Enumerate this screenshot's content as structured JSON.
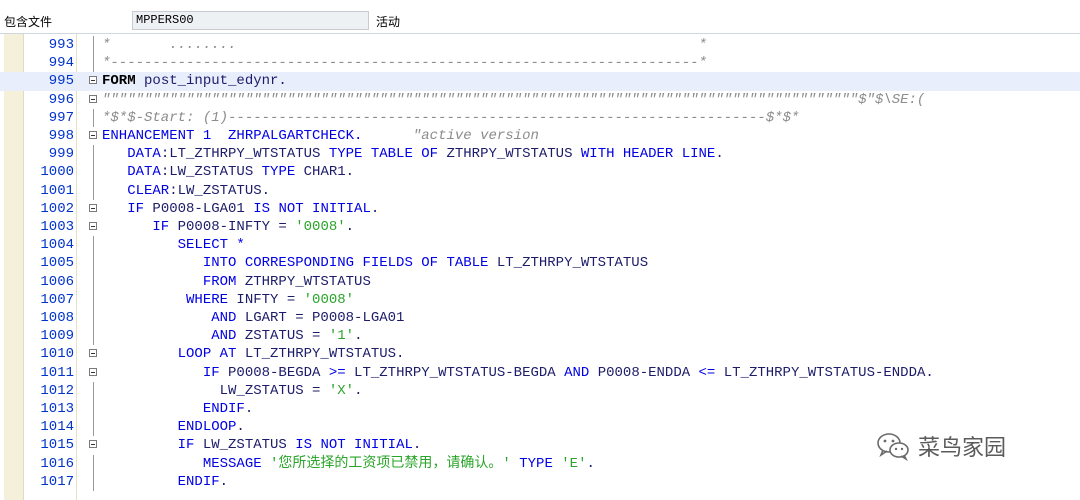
{
  "header": {
    "package_label": "包含文件",
    "include_name": "MPPERS00",
    "status": "活动"
  },
  "editor": {
    "lines": [
      {
        "n": "993",
        "segs": [
          {
            "t": "*       ........                                                       *",
            "c": "cm"
          }
        ]
      },
      {
        "n": "994",
        "segs": [
          {
            "t": "*----------------------------------------------------------------------*",
            "c": "cm"
          }
        ]
      },
      {
        "n": "995",
        "segs": [
          {
            "t": "FORM",
            "c": "bd"
          },
          {
            "t": " post_input_edynr.",
            "c": "tx"
          }
        ]
      },
      {
        "n": "996",
        "segs": [
          {
            "t": "\"\"\"\"\"\"\"\"\"\"\"\"\"\"\"\"\"\"\"\"\"\"\"\"\"\"\"\"\"\"\"\"\"\"\"\"\"\"\"\"\"\"\"\"\"\"\"\"\"\"\"\"\"\"\"\"\"\"\"\"\"\"\"\"\"\"\"\"\"\"\"\"\"\"\"\"\"\"\"\"\"\"\"\"\"\"\"\"\"\"$\"$\\SE:(",
            "c": "cm"
          }
        ]
      },
      {
        "n": "997",
        "segs": [
          {
            "t": "*$*$-Start: (1)----------------------------------------------------------------$*$*",
            "c": "cm"
          }
        ]
      },
      {
        "n": "998",
        "segs": [
          {
            "t": "ENHANCEMENT 1  ZHRPALGARTCHECK.      ",
            "c": "kw"
          },
          {
            "t": "\"active version",
            "c": "cm"
          }
        ]
      },
      {
        "n": "999",
        "segs": [
          {
            "t": "   DATA",
            "c": "kw"
          },
          {
            "t": ":LT_ZTHRPY_WTSTATUS ",
            "c": "tx"
          },
          {
            "t": "TYPE TABLE OF",
            "c": "kw"
          },
          {
            "t": " ZTHRPY_WTSTATUS ",
            "c": "tx"
          },
          {
            "t": "WITH HEADER LINE",
            "c": "kw"
          },
          {
            "t": ".",
            "c": "tx"
          }
        ]
      },
      {
        "n": "1000",
        "segs": [
          {
            "t": "   DATA",
            "c": "kw"
          },
          {
            "t": ":LW_ZSTATUS ",
            "c": "tx"
          },
          {
            "t": "TYPE",
            "c": "kw"
          },
          {
            "t": " CHAR1.",
            "c": "tx"
          }
        ]
      },
      {
        "n": "1001",
        "segs": [
          {
            "t": "   CLEAR",
            "c": "kw"
          },
          {
            "t": ":LW_ZSTATUS.",
            "c": "tx"
          }
        ]
      },
      {
        "n": "1002",
        "segs": [
          {
            "t": "   IF",
            "c": "kw"
          },
          {
            "t": " P0008-LGA01 ",
            "c": "tx"
          },
          {
            "t": "IS NOT INITIAL",
            "c": "kw"
          },
          {
            "t": ".",
            "c": "tx"
          }
        ]
      },
      {
        "n": "1003",
        "segs": [
          {
            "t": "      IF",
            "c": "kw"
          },
          {
            "t": " P0008-INFTY = ",
            "c": "tx"
          },
          {
            "t": "'0008'",
            "c": "st"
          },
          {
            "t": ".",
            "c": "tx"
          }
        ]
      },
      {
        "n": "1004",
        "segs": [
          {
            "t": "         SELECT *",
            "c": "kw"
          }
        ]
      },
      {
        "n": "1005",
        "segs": [
          {
            "t": "            INTO CORRESPONDING FIELDS OF TABLE",
            "c": "kw"
          },
          {
            "t": " LT_ZTHRPY_WTSTATUS",
            "c": "tx"
          }
        ]
      },
      {
        "n": "1006",
        "segs": [
          {
            "t": "            FROM",
            "c": "kw"
          },
          {
            "t": " ZTHRPY_WTSTATUS",
            "c": "tx"
          }
        ]
      },
      {
        "n": "1007",
        "segs": [
          {
            "t": "          WHERE",
            "c": "kw"
          },
          {
            "t": " INFTY = ",
            "c": "tx"
          },
          {
            "t": "'0008'",
            "c": "st"
          }
        ]
      },
      {
        "n": "1008",
        "segs": [
          {
            "t": "             AND",
            "c": "kw"
          },
          {
            "t": " LGART = P0008-LGA01",
            "c": "tx"
          }
        ]
      },
      {
        "n": "1009",
        "segs": [
          {
            "t": "             AND",
            "c": "kw"
          },
          {
            "t": " ZSTATUS = ",
            "c": "tx"
          },
          {
            "t": "'1'",
            "c": "st"
          },
          {
            "t": ".",
            "c": "tx"
          }
        ]
      },
      {
        "n": "1010",
        "segs": [
          {
            "t": "         LOOP AT",
            "c": "kw"
          },
          {
            "t": " LT_ZTHRPY_WTSTATUS.",
            "c": "tx"
          }
        ]
      },
      {
        "n": "1011",
        "segs": [
          {
            "t": "            IF",
            "c": "kw"
          },
          {
            "t": " P0008-BEGDA ",
            "c": "tx"
          },
          {
            "t": ">=",
            "c": "kw"
          },
          {
            "t": " LT_ZTHRPY_WTSTATUS-BEGDA ",
            "c": "tx"
          },
          {
            "t": "AND",
            "c": "kw"
          },
          {
            "t": " P0008-ENDDA ",
            "c": "tx"
          },
          {
            "t": "<=",
            "c": "kw"
          },
          {
            "t": " LT_ZTHRPY_WTSTATUS-ENDDA.",
            "c": "tx"
          }
        ]
      },
      {
        "n": "1012",
        "segs": [
          {
            "t": "              LW_ZSTATUS = ",
            "c": "tx"
          },
          {
            "t": "'X'",
            "c": "st"
          },
          {
            "t": ".",
            "c": "tx"
          }
        ]
      },
      {
        "n": "1013",
        "segs": [
          {
            "t": "            ENDIF",
            "c": "kw"
          },
          {
            "t": ".",
            "c": "tx"
          }
        ]
      },
      {
        "n": "1014",
        "segs": [
          {
            "t": "         ENDLOOP",
            "c": "kw"
          },
          {
            "t": ".",
            "c": "tx"
          }
        ]
      },
      {
        "n": "1015",
        "segs": [
          {
            "t": "         IF",
            "c": "kw"
          },
          {
            "t": " LW_ZSTATUS ",
            "c": "tx"
          },
          {
            "t": "IS NOT INITIAL",
            "c": "kw"
          },
          {
            "t": ".",
            "c": "tx"
          }
        ]
      },
      {
        "n": "1016",
        "segs": [
          {
            "t": "            MESSAGE ",
            "c": "kw"
          },
          {
            "t": "'您所选择的工资项已禁用，请确认。'",
            "c": "st"
          },
          {
            "t": " TYPE ",
            "c": "kw"
          },
          {
            "t": "'E'",
            "c": "st"
          },
          {
            "t": ".",
            "c": "tx"
          }
        ]
      },
      {
        "n": "1017",
        "segs": [
          {
            "t": "         ENDIF",
            "c": "kw"
          },
          {
            "t": ".",
            "c": "tx"
          }
        ]
      }
    ]
  },
  "watermark": {
    "text": "菜鸟家园",
    "icon": "wechat-icon"
  }
}
